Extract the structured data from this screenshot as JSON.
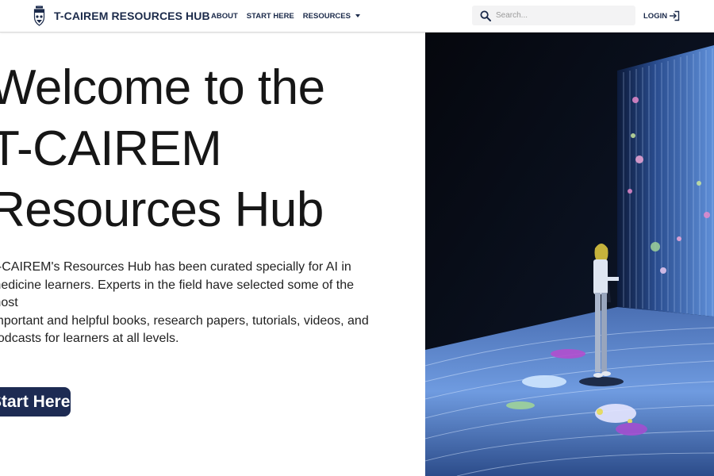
{
  "header": {
    "brand": "T-CAIREM RESOURCES HUB",
    "nav": [
      {
        "label": "ABOUT"
      },
      {
        "label": "START HERE"
      },
      {
        "label": "RESOURCES",
        "has_dropdown": true
      }
    ],
    "search": {
      "placeholder": "Search...",
      "value": ""
    },
    "login": "LOGIN"
  },
  "hero": {
    "title_lines": [
      "Welcome to the",
      "T-CAIREM",
      "Resources Hub"
    ],
    "description_lines": [
      "T-CAIREM's Resources Hub has been curated specially for AI in",
      "medicine learners. Experts in the field have selected some of the most",
      "important and helpful books, research papers, tutorials, videos, and",
      "podcasts for learners at all levels."
    ],
    "cta_label": "Start Here"
  },
  "icons": {
    "crest": "university-crest-icon",
    "search": "search-icon",
    "login": "login-icon",
    "dropdown": "caret-down-icon"
  },
  "colors": {
    "brand_navy": "#1b2a4a",
    "button_navy": "#1d2b53",
    "search_bg": "#f3f3f4"
  }
}
